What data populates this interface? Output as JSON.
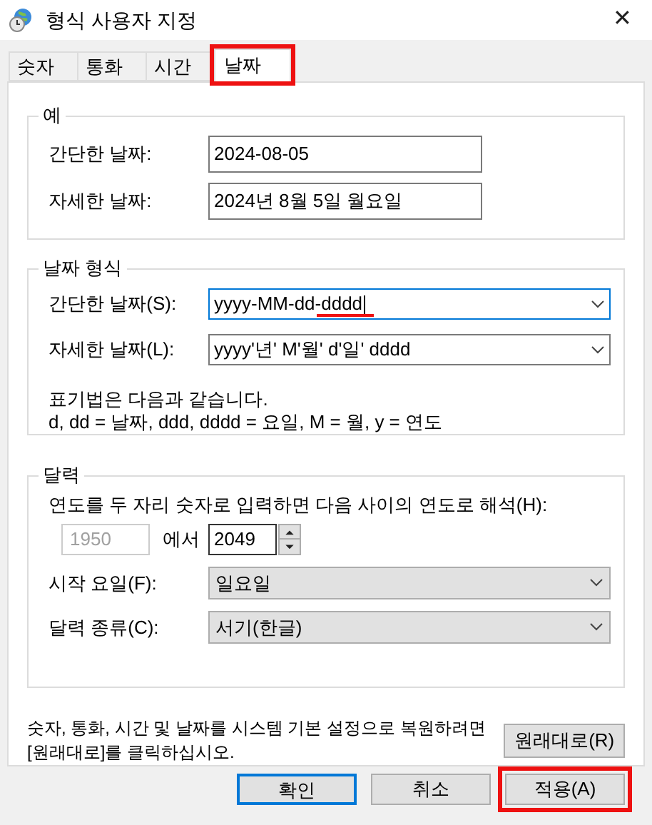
{
  "window": {
    "title": "형식 사용자 지정",
    "close": "✕"
  },
  "tabs": [
    {
      "label": "숫자",
      "selected": false,
      "annotated": false
    },
    {
      "label": "통화",
      "selected": false,
      "annotated": false
    },
    {
      "label": "시간",
      "selected": false,
      "annotated": false
    },
    {
      "label": "날짜",
      "selected": true,
      "annotated": true
    }
  ],
  "example": {
    "title": "예",
    "rows": [
      {
        "label": "간단한 날짜:",
        "value": "2024-08-05"
      },
      {
        "label": "자세한 날짜:",
        "value": "2024년 8월 5일 월요일"
      }
    ]
  },
  "date_format": {
    "title": "날짜 형식",
    "rows": [
      {
        "label": "간단한 날짜(S):",
        "value": "yyyy-MM-dd-dddd",
        "focused": true,
        "annotated": true
      },
      {
        "label": "자세한 날짜(L):",
        "value": "yyyy'년' M'월' d'일' dddd",
        "focused": false,
        "annotated": false
      }
    ],
    "notes": [
      "표기법은 다음과 같습니다.",
      "d, dd = 날짜,  ddd, dddd = 요일,  M = 월,  y = 연도"
    ]
  },
  "calendar": {
    "title": "달력",
    "two_digit_label": "연도를 두 자리 숫자로 입력하면 다음 사이의 연도로 해석(H):",
    "from_year": {
      "value": "1950",
      "disabled": true
    },
    "between": "에서",
    "to_year": {
      "value": "2049"
    },
    "rows": [
      {
        "label": "시작 요일(F):",
        "value": "일요일"
      },
      {
        "label": "달력 종류(C):",
        "value": "서기(한글)"
      }
    ]
  },
  "reset": {
    "text": "숫자, 통화, 시간 및 날짜를 시스템 기본 설정으로 복원하려면 [원래대로]를 클릭하십시오.",
    "button": "원래대로(R)"
  },
  "buttons": [
    {
      "label": "확인",
      "default": true,
      "annotated": false
    },
    {
      "label": "취소",
      "default": false,
      "annotated": false
    },
    {
      "label": "적용(A)",
      "default": false,
      "annotated": true
    }
  ]
}
